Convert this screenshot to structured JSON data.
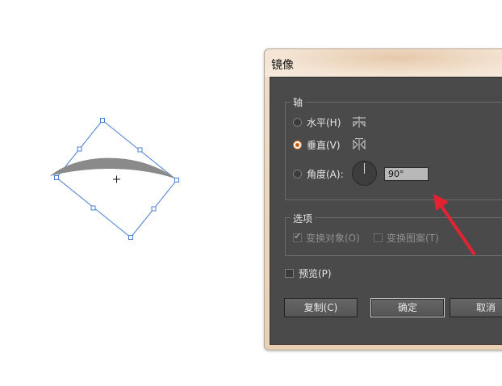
{
  "dialog": {
    "title": "镜像",
    "axis_group": {
      "label": "轴",
      "horizontal": {
        "label": "水平(H)",
        "selected": false,
        "icon": "mirror-horizontal-icon"
      },
      "vertical": {
        "label": "垂直(V)",
        "selected": true,
        "icon": "mirror-vertical-icon"
      },
      "angle": {
        "label": "角度(A):",
        "selected": false,
        "value": "90°",
        "icon": "angle-dial-icon"
      }
    },
    "options_group": {
      "label": "选项",
      "transform_objects": {
        "label": "变换对象(O)",
        "checked": true,
        "disabled": true
      },
      "transform_patterns": {
        "label": "变换图案(T)",
        "checked": false,
        "disabled": true
      }
    },
    "preview": {
      "label": "预览(P)",
      "checked": false
    },
    "buttons": {
      "copy": "复制(C)",
      "ok": "确定",
      "cancel": "取消"
    }
  },
  "colors": {
    "selection": "#4a7fd4",
    "shape_fill": "#8a8a8a",
    "panel": "#4a4a4a",
    "arrow": "#e52232",
    "accent_radio": "#e07a2b"
  }
}
